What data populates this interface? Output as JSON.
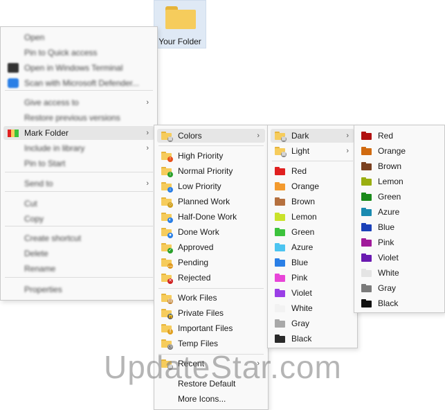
{
  "desktop_folder": {
    "label": "Your Folder"
  },
  "main_menu": {
    "items": [
      {
        "label": "Open",
        "blurred": true
      },
      {
        "label": "Pin to Quick access",
        "blurred": true
      },
      {
        "label": "Open in Windows Terminal",
        "blurred": true
      },
      {
        "label": "Scan with Microsoft Defender...",
        "blurred": true
      },
      {
        "label": "Give access to",
        "blurred": true,
        "submenu": true
      },
      {
        "label": "Restore previous versions",
        "blurred": true
      },
      {
        "label": "Mark Folder",
        "blurred": false,
        "submenu": true
      },
      {
        "label": "Include in library",
        "blurred": true,
        "submenu": true
      },
      {
        "label": "Pin to Start",
        "blurred": true
      },
      {
        "label": "Send to",
        "blurred": true,
        "submenu": true
      },
      {
        "label": "Cut",
        "blurred": true
      },
      {
        "label": "Copy",
        "blurred": true
      },
      {
        "label": "Create shortcut",
        "blurred": true
      },
      {
        "label": "Delete",
        "blurred": true
      },
      {
        "label": "Rename",
        "blurred": true
      },
      {
        "label": "Properties",
        "blurred": true
      }
    ]
  },
  "mark_folder_menu": {
    "colors": "Colors",
    "priorities": [
      "High Priority",
      "Normal Priority",
      "Low Priority"
    ],
    "states": [
      "Planned Work",
      "Half-Done Work",
      "Done Work",
      "Approved",
      "Pending",
      "Rejected"
    ],
    "files": [
      "Work Files",
      "Private Files",
      "Important Files",
      "Temp Files"
    ],
    "recent": "Recent",
    "restore": "Restore Default",
    "more": "More Icons..."
  },
  "colors_menu": {
    "dark": "Dark",
    "light": "Light",
    "colors": [
      {
        "name": "Red",
        "hex": "#e02020"
      },
      {
        "name": "Orange",
        "hex": "#f39a2e"
      },
      {
        "name": "Brown",
        "hex": "#b5703e"
      },
      {
        "name": "Lemon",
        "hex": "#c9e22a"
      },
      {
        "name": "Green",
        "hex": "#3cc23c"
      },
      {
        "name": "Azure",
        "hex": "#4cc4f0"
      },
      {
        "name": "Blue",
        "hex": "#2a7fe6"
      },
      {
        "name": "Pink",
        "hex": "#e845d8"
      },
      {
        "name": "Violet",
        "hex": "#9a3ee6"
      },
      {
        "name": "White",
        "hex": "#f2f2f2"
      },
      {
        "name": "Gray",
        "hex": "#a8a8a8"
      },
      {
        "name": "Black",
        "hex": "#2a2a2a"
      }
    ]
  },
  "dark_menu": {
    "colors": [
      {
        "name": "Red",
        "hex": "#b01010"
      },
      {
        "name": "Orange",
        "hex": "#d06a10"
      },
      {
        "name": "Brown",
        "hex": "#7a4020"
      },
      {
        "name": "Lemon",
        "hex": "#9aae10"
      },
      {
        "name": "Green",
        "hex": "#1a8a1a"
      },
      {
        "name": "Azure",
        "hex": "#1a8ab0"
      },
      {
        "name": "Blue",
        "hex": "#1a40b8"
      },
      {
        "name": "Pink",
        "hex": "#a01a9a"
      },
      {
        "name": "Violet",
        "hex": "#6a1ab0"
      },
      {
        "name": "White",
        "hex": "#e4e4e4"
      },
      {
        "name": "Gray",
        "hex": "#7a7a7a"
      },
      {
        "name": "Black",
        "hex": "#101010"
      }
    ]
  },
  "watermark": "UpdateStar.com",
  "icon_colors": {
    "folder_yellow": "#f6cc5c",
    "folder_yellow_dark": "#e6b43a",
    "high": "#e8501a",
    "normal": "#2aa02a",
    "low": "#2a7fe6",
    "approved": "#2aa02a",
    "pending": "#e09a20",
    "rejected": "#d02020"
  }
}
